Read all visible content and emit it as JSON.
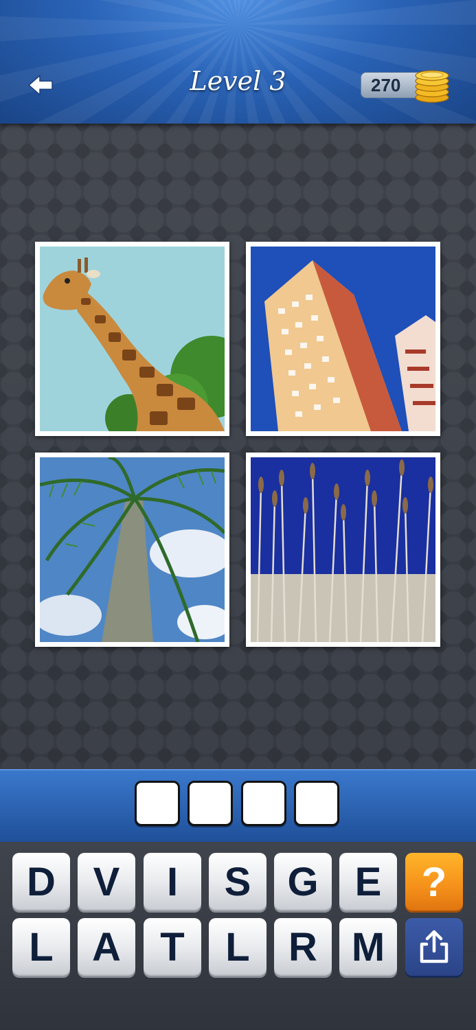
{
  "header": {
    "back_icon": "back-arrow-icon",
    "title": "Level 3",
    "coins": "270",
    "coins_icon": "gold-coins-icon"
  },
  "pictures": [
    {
      "subject": "giraffe",
      "icon": "giraffe-photo"
    },
    {
      "subject": "tall apartment building",
      "icon": "building-photo"
    },
    {
      "subject": "palm tree",
      "icon": "palm-tree-photo"
    },
    {
      "subject": "tall reeds",
      "icon": "reeds-photo"
    }
  ],
  "answer": {
    "slots": [
      "",
      "",
      "",
      ""
    ]
  },
  "keyboard": {
    "row1": [
      "D",
      "V",
      "I",
      "S",
      "G",
      "E"
    ],
    "row2": [
      "L",
      "A",
      "T",
      "L",
      "R",
      "M"
    ],
    "hint_label": "?",
    "share_icon": "share-icon"
  },
  "colors": {
    "header_blue": "#2a64b8",
    "hint_orange": "#f5901a",
    "share_blue": "#2b4488",
    "key_text": "#0f1f3a"
  }
}
